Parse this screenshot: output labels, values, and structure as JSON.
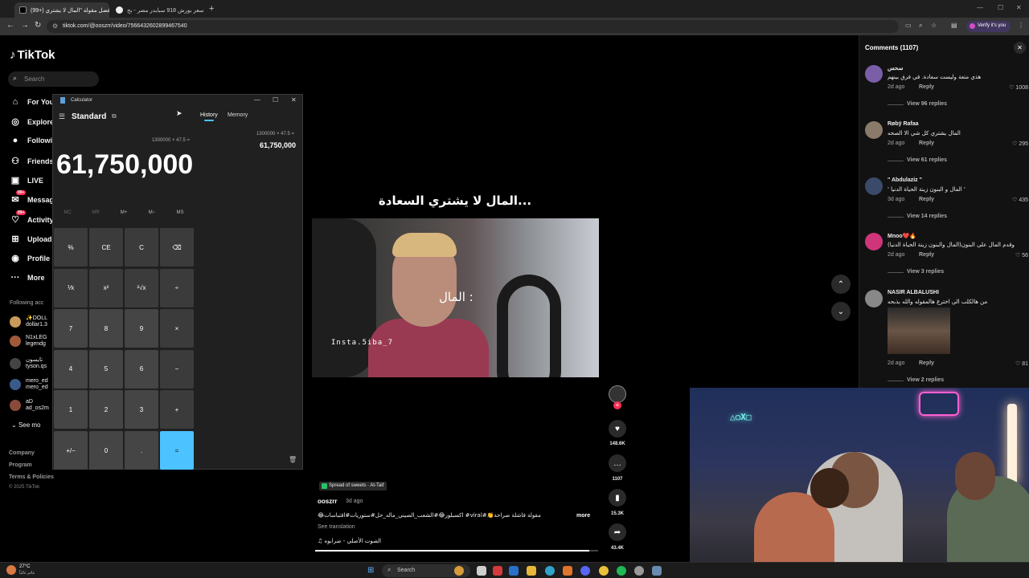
{
  "browser": {
    "tabs": [
      {
        "label": "(99+) أفضل مقولة \"المال لا يشتري",
        "active": true
      },
      {
        "label": "سعر بورش 918 سبايدر مصر - بح",
        "active": false
      }
    ],
    "url": "tiktok.com/@ooszrr/video/7566432602899467540",
    "verify_label": "Verify it's you"
  },
  "tiktok": {
    "logo": "TikTok",
    "search_placeholder": "Search",
    "nav": [
      {
        "label": "For You",
        "icon": "home-icon"
      },
      {
        "label": "Explore",
        "icon": "compass-icon"
      },
      {
        "label": "Following",
        "icon": "following-icon"
      },
      {
        "label": "Friends",
        "icon": "friends-icon"
      },
      {
        "label": "LIVE",
        "icon": "live-icon"
      },
      {
        "label": "Messages",
        "icon": "messages-icon",
        "badge": "99+"
      },
      {
        "label": "Activity",
        "icon": "activity-icon",
        "badge": "99+"
      },
      {
        "label": "Upload",
        "icon": "upload-icon"
      },
      {
        "label": "Profile",
        "icon": "profile-icon"
      },
      {
        "label": "More",
        "icon": "more-icon"
      }
    ],
    "following_header": "Following acc",
    "following": [
      {
        "name": "✨DOLL",
        "handle": "dollar1.3"
      },
      {
        "name": "N1xLEG",
        "handle": "legendg"
      },
      {
        "name": "تايسون",
        "handle": "tyson.qs"
      },
      {
        "name": "mero_ed",
        "handle": "mero_ed"
      },
      {
        "name": "aD",
        "handle": "ad_os2m"
      }
    ],
    "see_more": "See mo",
    "footer": [
      "Company",
      "Program",
      "Terms & Policies"
    ],
    "copyright": "© 2025 TikTok"
  },
  "calculator": {
    "title": "Calculator",
    "mode": "Standard",
    "tabs": [
      "History",
      "Memory"
    ],
    "expression": "1300000 × 47.5 =",
    "display": "61,750,000",
    "history": {
      "expression": "1300000  ×  47.5 =",
      "result": "61,750,000"
    },
    "memory_keys": [
      "MC",
      "MR",
      "M+",
      "M−",
      "MS"
    ],
    "keys": [
      [
        "%",
        "CE",
        "C",
        "⌫"
      ],
      [
        "⅟x",
        "x²",
        "²√x",
        "÷"
      ],
      [
        "7",
        "8",
        "9",
        "×"
      ],
      [
        "4",
        "5",
        "6",
        "−"
      ],
      [
        "1",
        "2",
        "3",
        "+"
      ],
      [
        "+/−",
        "0",
        ".",
        "="
      ]
    ]
  },
  "video": {
    "overlay_text": "المال لا يشتري السعادة...",
    "caption_in_video": "المال :",
    "watermark": "Insta.5iba_7",
    "progress": 0.97,
    "music_chip": "Spread of sweets · At-Taif",
    "author": "ooszrr",
    "date": "3d ago",
    "description": "مقولة فاشلة صراحة👏#viral# اكسبلور😂#الشعب_الصيني_ماله_حل#ستوريات#اقتباسات😂",
    "more": "more",
    "see_translation": "See translation",
    "sound": "الصوت الأصلي - ضرابوه",
    "likes": "148.6K",
    "comments": "1107",
    "saves": "15.3K",
    "shares": "43.4K"
  },
  "comments": {
    "title": "Comments (1107)",
    "items": [
      {
        "user": "سحس",
        "text": "هذي متعة وليست سعادة. في فرق بينهم",
        "date": "2d ago",
        "likes": "1008",
        "view": "View 96 replies",
        "color": "#7a5fa8"
      },
      {
        "user": "Røbÿ Rafaa",
        "text": "المال يشتري كل شي الا الصحه",
        "date": "2d ago",
        "likes": "295",
        "view": "View 61 replies",
        "color": "#8a7a6a"
      },
      {
        "user": "\" Abdulaziz \"",
        "text": "' المال و البنون زينة الحياة الدنيا '",
        "date": "3d ago",
        "likes": "435",
        "view": "View 14 replies",
        "color": "#3a4a6a"
      },
      {
        "user": "Mnoo❤️🔥",
        "text": "وقدم المال على البنون(المال والبنون زينة الحياة الدنيا)",
        "date": "2d ago",
        "likes": "56",
        "view": "View 3 replies",
        "color": "#d0357a"
      },
      {
        "user": "NASIR ALBALUSHI",
        "text": "من هالكلب الي اخترع هالمقوله والله بذبحه",
        "date": "2d ago",
        "likes": "81",
        "view": "View 2 replies",
        "color": "#888888"
      }
    ],
    "reply_label": "Reply"
  },
  "taskbar": {
    "temp": "27°C",
    "weather": "غائم غالباً",
    "search_placeholder": "Search"
  }
}
